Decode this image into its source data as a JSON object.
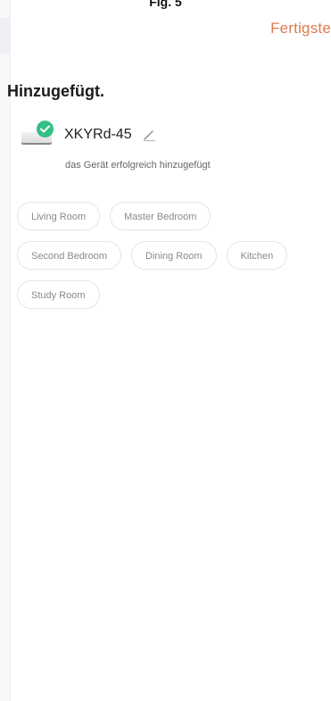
{
  "figure_label": "Fig. 5",
  "header": {
    "done_label": "Fertigste"
  },
  "section_title": "Hinzugefügt.",
  "device": {
    "name": "XKYRd-45",
    "status_text": "das Gerät erfolgreich hinzugefügt",
    "status_color": "#35bf87",
    "icons": [
      "device-image",
      "check-icon",
      "edit-pencil-icon"
    ]
  },
  "rooms": [
    {
      "label": "Living Room"
    },
    {
      "label": "Master Bedroom"
    },
    {
      "label": "Second Bedroom"
    },
    {
      "label": "Dining Room"
    },
    {
      "label": "Kitchen"
    },
    {
      "label": "Study Room"
    }
  ],
  "colors": {
    "accent": "#e07a4e",
    "success": "#35bf87"
  }
}
